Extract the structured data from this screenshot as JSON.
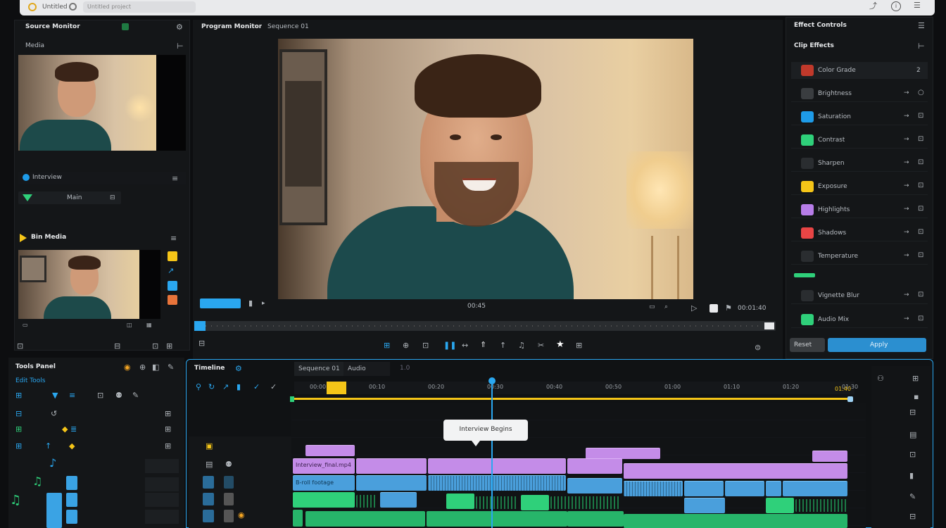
{
  "topbar": {
    "tab_label": "Untitled",
    "address": "Untitled project"
  },
  "source_panel": {
    "title": "Source Monitor",
    "subtitle": "Media",
    "clip_label": "Interview",
    "track_label": "Main"
  },
  "bin_panel": {
    "title": "Bin Media"
  },
  "viewer": {
    "tab1": "Program Monitor",
    "tab2": "Sequence 01",
    "timecode": "00:45",
    "duration": "00:01:40"
  },
  "right_panel": {
    "title": "Effect Controls",
    "subtitle": "Clip Effects",
    "items": [
      {
        "label": "Color Grade",
        "value": "2",
        "color": "#c0392b"
      },
      {
        "label": "Brightness",
        "color": "#3a3d40"
      },
      {
        "label": "Saturation",
        "color": "#1e9be8"
      },
      {
        "label": "Contrast",
        "color": "#2fd07a"
      },
      {
        "label": "Sharpen",
        "color": "#2a2d30"
      },
      {
        "label": "Exposure",
        "color": "#f5c518"
      },
      {
        "label": "Highlights",
        "color": "#b77de8"
      },
      {
        "label": "Shadows",
        "color": "#e84545"
      },
      {
        "label": "Temperature",
        "color": "#2a2d30"
      },
      {
        "label": "Vignette Blur",
        "color": "#2a2d30"
      },
      {
        "label": "Audio Mix",
        "color": "#2fd07a"
      }
    ],
    "reset_label": "Reset",
    "apply_label": "Apply"
  },
  "tools_panel": {
    "title": "Tools Panel",
    "subtitle": "Edit Tools"
  },
  "timeline": {
    "title": "Timeline",
    "tab1": "Sequence 01",
    "tab2": "Audio",
    "tab3": "1.0",
    "ruler": [
      "00:00",
      "00:10",
      "00:20",
      "00:30",
      "00:40",
      "00:50",
      "01:00",
      "01:10",
      "01:20",
      "01:30"
    ],
    "end_label": "01:40",
    "tooltip": "Interview Begins",
    "clip_label": "Interview_final.mp4",
    "clip_label2": "B-roll footage"
  },
  "colors": {
    "accent": "#2aa7f0",
    "playhead": "#2aa7f0",
    "marker": "#f5c518"
  }
}
